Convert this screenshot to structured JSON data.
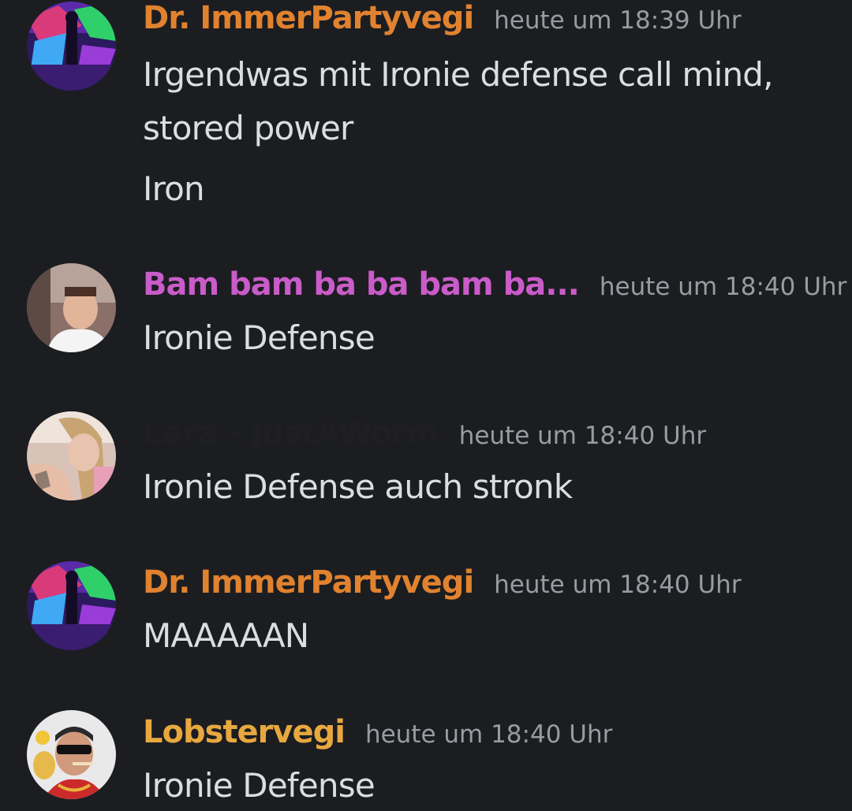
{
  "messages": [
    {
      "username": "Dr. ImmerPartyvegi",
      "username_color": "#e0822f",
      "timestamp": "heute um 18:39 Uhr",
      "lines": [
        "Irgendwas mit Ironie defense call mind,",
        "stored power"
      ],
      "extra_message": "Iron"
    },
    {
      "username": "Bam bam ba ba bam ba...",
      "username_color": "#c95cc9",
      "timestamp": "heute um 18:40 Uhr",
      "lines": [
        "Ironie Defense"
      ]
    },
    {
      "username": "Lara - JustAWorm",
      "username_color": "#1f1f22",
      "timestamp": "heute um 18:40 Uhr",
      "lines": [
        "Ironie Defense auch stronk"
      ]
    },
    {
      "username": "Dr. ImmerPartyvegi",
      "username_color": "#e0822f",
      "timestamp": "heute um 18:40 Uhr",
      "lines": [
        "MAAAAAN"
      ]
    },
    {
      "username": "Lobstervegi",
      "username_color": "#e7a83f",
      "timestamp": "heute um 18:40 Uhr",
      "lines": [
        "Ironie Defense"
      ]
    }
  ]
}
